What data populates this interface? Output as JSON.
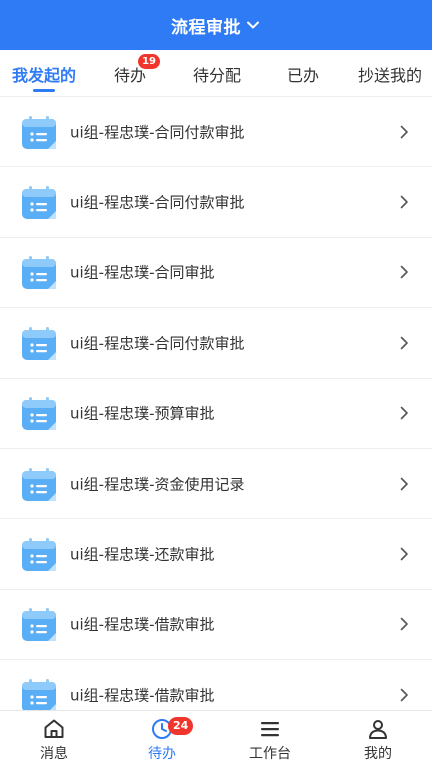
{
  "header": {
    "title": "流程审批"
  },
  "tabs": [
    {
      "label": "我发起的",
      "active": true
    },
    {
      "label": "待办",
      "badge": "19"
    },
    {
      "label": "待分配"
    },
    {
      "label": "已办"
    },
    {
      "label": "抄送我的"
    }
  ],
  "list": {
    "items": [
      {
        "label": "ui组-程忠璞-合同付款审批"
      },
      {
        "label": "ui组-程忠璞-合同付款审批"
      },
      {
        "label": "ui组-程忠璞-合同审批"
      },
      {
        "label": "ui组-程忠璞-合同付款审批"
      },
      {
        "label": "ui组-程忠璞-预算审批"
      },
      {
        "label": "ui组-程忠璞-资金使用记录"
      },
      {
        "label": "ui组-程忠璞-还款审批"
      },
      {
        "label": "ui组-程忠璞-借款审批"
      },
      {
        "label": "ui组-程忠璞-借款审批"
      }
    ]
  },
  "bottom_nav": [
    {
      "label": "消息",
      "icon": "home-icon"
    },
    {
      "label": "待办",
      "icon": "clock-icon",
      "badge": "24",
      "active": true
    },
    {
      "label": "工作台",
      "icon": "menu-icon"
    },
    {
      "label": "我的",
      "icon": "user-icon"
    }
  ],
  "colors": {
    "primary": "#2f7bf5",
    "badge": "#f0352d",
    "list_icon": "#5aaef5"
  }
}
